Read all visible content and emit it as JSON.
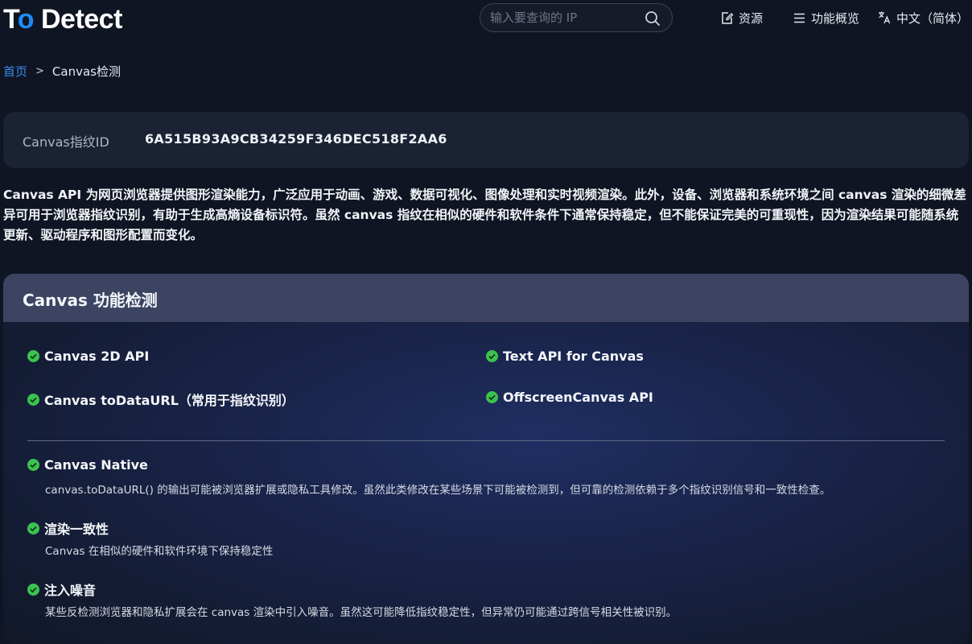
{
  "header": {
    "logo": {
      "part1": "T",
      "part2": "o",
      "part3": " Detect"
    },
    "search": {
      "placeholder": "输入要查询的 IP"
    },
    "nav": [
      {
        "label": "资源",
        "icon": "edit-document-icon"
      },
      {
        "label": "功能概览",
        "icon": "menu-icon"
      },
      {
        "label": "中文（简体）",
        "icon": "translate-icon"
      }
    ]
  },
  "breadcrumb": {
    "home": "首页",
    "separator": ">",
    "current": "Canvas检测"
  },
  "fingerprint": {
    "label": "Canvas指纹ID",
    "value": "6A515B93A9CB34259F346DEC518F2AA6"
  },
  "description": "Canvas API 为网页浏览器提供图形渲染能力，广泛应用于动画、游戏、数据可视化、图像处理和实时视频渲染。此外，设备、浏览器和系统环境之间 canvas 渲染的细微差异可用于浏览器指纹识别，有助于生成高熵设备标识符。虽然 canvas 指纹在相似的硬件和软件条件下通常保持稳定，但不能保证完美的可重现性，因为渲染结果可能随系统更新、驱动程序和图形配置而变化。",
  "panel": {
    "title": "Canvas 功能检测",
    "features": [
      "Canvas 2D API",
      "Text API for Canvas",
      "Canvas toDataURL（常用于指纹识别）",
      "OffscreenCanvas API"
    ],
    "details": [
      {
        "title": "Canvas Native",
        "text": "canvas.toDataURL() 的输出可能被浏览器扩展或隐私工具修改。虽然此类修改在某些场景下可能被检测到，但可靠的检测依赖于多个指纹识别信号和一致性检查。"
      },
      {
        "title": "渲染一致性",
        "text": "Canvas 在相似的硬件和软件环境下保持稳定性"
      },
      {
        "title": "注入噪音",
        "text": "某些反检测浏览器和隐私扩展会在 canvas 渲染中引入噪音。虽然这可能降低指纹稳定性，但异常仍可能通过跨信号相关性被识别。"
      }
    ]
  },
  "colors": {
    "accent": "#1e8bf5",
    "check": "#3cc24f",
    "link": "#3b8cf0"
  }
}
